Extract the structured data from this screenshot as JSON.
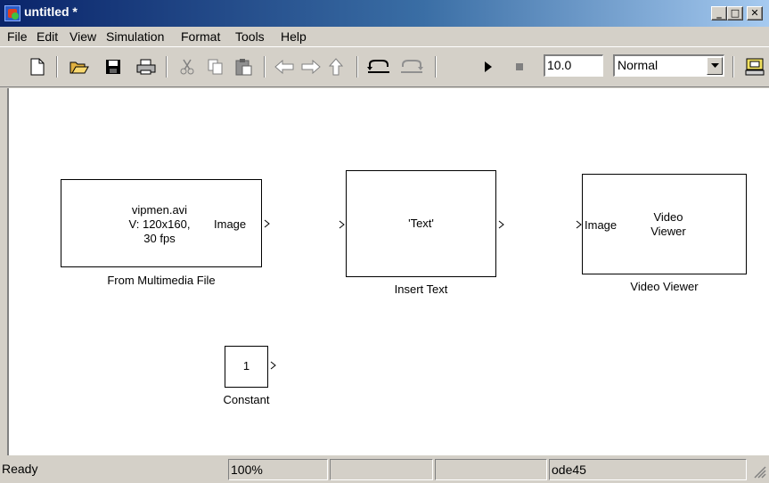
{
  "window": {
    "title": "untitled *",
    "min": "_",
    "max": "□",
    "close": "✕"
  },
  "menu": [
    "File",
    "Edit",
    "View",
    "Simulation",
    "Format",
    "Tools",
    "Help"
  ],
  "toolbar": {
    "stop_time": "10.0",
    "sim_mode": "Normal",
    "icons": [
      "new-icon",
      "open-icon",
      "save-icon",
      "print-icon",
      "cut-icon",
      "copy-icon",
      "paste-icon",
      "back-icon",
      "forward-icon",
      "up-icon",
      "undo-icon",
      "redo-icon",
      "run-icon",
      "stop-icon",
      "build-icon"
    ]
  },
  "blocks": {
    "from_file": {
      "line1": "vipmen.avi",
      "line2": "V: 120x160,",
      "line3": "30 fps",
      "port_out": "Image",
      "label": "From Multimedia File"
    },
    "insert_text": {
      "content": "'Text'",
      "label": "Insert Text"
    },
    "video_viewer": {
      "port_in": "Image",
      "line1": "Video",
      "line2": "Viewer",
      "label": "Video Viewer"
    },
    "constant": {
      "value": "1",
      "label": "Constant"
    }
  },
  "status": {
    "state": "Ready",
    "zoom": "100%",
    "solver": "ode45"
  }
}
